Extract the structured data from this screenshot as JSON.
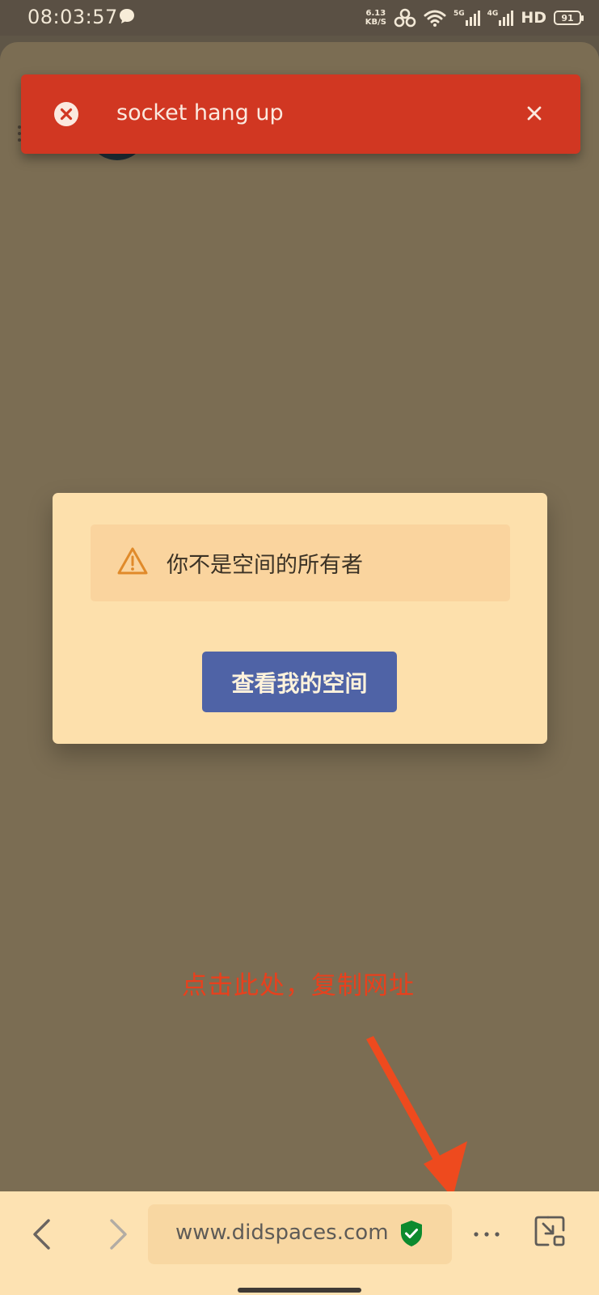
{
  "status_bar": {
    "time": "08:03:57",
    "net_speed_value": "6.13",
    "net_speed_unit": "KB/S",
    "signal_1_label": "5G",
    "signal_2_label": "4G",
    "hd_label": "HD",
    "battery_level": "91",
    "icons": [
      "chat-bubble-icon",
      "hotspot-icon",
      "wifi-icon",
      "signal-icon",
      "battery-icon"
    ]
  },
  "toast": {
    "message": "socket hang up",
    "color": "#d13722",
    "icons": [
      "error-circle-icon",
      "close-icon"
    ]
  },
  "dialog": {
    "alert_text": "你不是空间的所有者",
    "button_label": "查看我的空间",
    "button_color": "#4f63a6",
    "icons": [
      "warning-triangle-icon"
    ]
  },
  "annotation": {
    "text": "点击此处，复制网址",
    "color": "#e8401d"
  },
  "browser_toolbar": {
    "url": "www.didspaces.com",
    "icons": [
      "back-icon",
      "forward-icon",
      "shield-check-icon",
      "more-icon",
      "exit-fullscreen-icon"
    ]
  }
}
